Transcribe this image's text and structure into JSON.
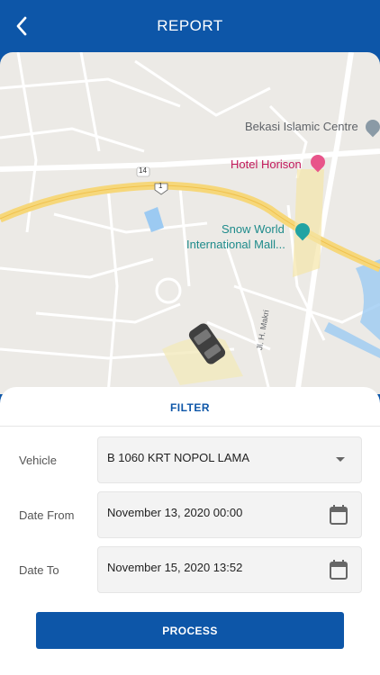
{
  "header": {
    "title": "REPORT",
    "back_icon": "chevron-left-icon"
  },
  "map": {
    "labels": {
      "islamic_centre": "Bekasi Islamic Centre",
      "hotel": "Hotel Horison",
      "mall_line1": "Snow World",
      "mall_line2": "International Mall...",
      "street": "Jl. H. Makri",
      "road_14": "14",
      "road_1": "1"
    },
    "vehicle_icon": "car-icon"
  },
  "filter": {
    "title": "FILTER",
    "vehicle": {
      "label": "Vehicle",
      "value": "B 1060 KRT NOPOL LAMA"
    },
    "date_from": {
      "label": "Date From",
      "value": "November 13, 2020 00:00"
    },
    "date_to": {
      "label": "Date To",
      "value": "November 15, 2020 13:52"
    },
    "process_label": "PROCESS"
  },
  "colors": {
    "primary": "#0d56a8",
    "map_bg": "#eceae6",
    "highway": "#f6d77a",
    "water": "#9ccaf2"
  }
}
